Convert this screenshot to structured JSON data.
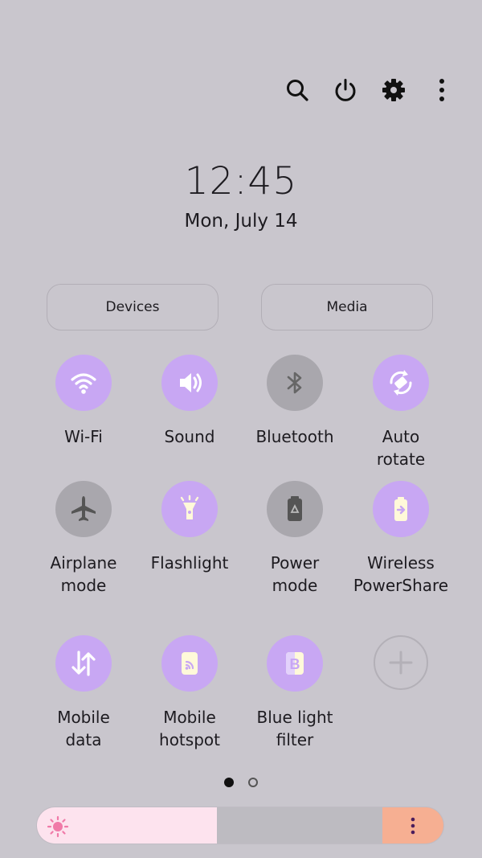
{
  "toolbar": {
    "icons": [
      "search-icon",
      "power-icon",
      "gear-icon",
      "more-vert-icon"
    ]
  },
  "clock": {
    "time": "12:45",
    "date": "Mon, July 14"
  },
  "buttons": {
    "devices": "Devices",
    "media": "Media"
  },
  "tiles": [
    {
      "label": "Wi-Fi",
      "icon": "wifi-icon",
      "state": "on"
    },
    {
      "label": "Sound",
      "icon": "sound-icon",
      "state": "on"
    },
    {
      "label": "Bluetooth",
      "icon": "bluetooth-icon",
      "state": "off"
    },
    {
      "label": "Auto\nrotate",
      "icon": "auto-rotate-icon",
      "state": "on"
    },
    {
      "label": "Airplane\nmode",
      "icon": "airplane-icon",
      "state": "off"
    },
    {
      "label": "Flashlight",
      "icon": "flashlight-icon",
      "state": "on"
    },
    {
      "label": "Power\nmode",
      "icon": "battery-recycle-icon",
      "state": "off"
    },
    {
      "label": "Wireless\nPowerShare",
      "icon": "wireless-powershare-icon",
      "state": "on"
    },
    {
      "label": "Mobile\ndata",
      "icon": "mobile-data-icon",
      "state": "on"
    },
    {
      "label": "Mobile\nhotspot",
      "icon": "hotspot-icon",
      "state": "on"
    },
    {
      "label": "Blue light\nfilter",
      "icon": "blue-light-filter-icon",
      "state": "on"
    },
    {
      "label": "",
      "icon": "add-icon",
      "state": "add"
    }
  ],
  "pager": {
    "pages": 2,
    "current": 1
  },
  "brightness": {
    "level": 0.44
  },
  "colors": {
    "background": "#c9c6cd",
    "accent": "#c8a7f3",
    "inactive": "#a9a7ad",
    "brightness_fill": "#fde3ee",
    "brightness_end": "#f6af92"
  }
}
